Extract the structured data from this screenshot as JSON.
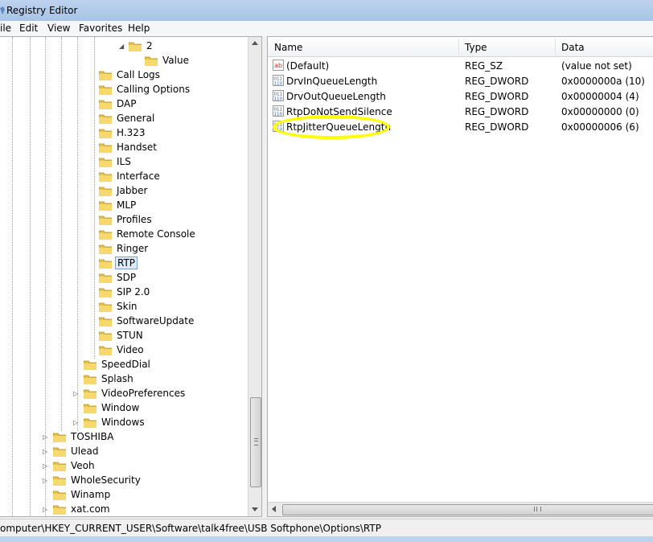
{
  "window": {
    "title": "Registry Editor"
  },
  "menu": [
    "ile",
    "Edit",
    "View",
    "Favorites",
    "Help"
  ],
  "tree": {
    "top": [
      {
        "label": "2",
        "expanded": true
      },
      {
        "label": "Value"
      }
    ],
    "options_children": [
      "Call Logs",
      "Calling Options",
      "DAP",
      "General",
      "H.323",
      "Handset",
      "ILS",
      "Interface",
      "Jabber",
      "MLP",
      "Profiles",
      "Remote Console",
      "Ringer",
      "RTP",
      "SDP",
      "SIP 2.0",
      "Skin",
      "SoftwareUpdate",
      "STUN",
      "Video"
    ],
    "selected": "RTP",
    "softphone_children": [
      {
        "label": "SpeedDial"
      },
      {
        "label": "Splash"
      },
      {
        "label": "VideoPreferences",
        "expandable": true
      },
      {
        "label": "Window"
      },
      {
        "label": "Windows",
        "expandable": true
      }
    ],
    "software_children": [
      {
        "label": "TOSHIBA",
        "expandable": true
      },
      {
        "label": "Ulead",
        "expandable": true
      },
      {
        "label": "Veoh",
        "expandable": true
      },
      {
        "label": "WholeSecurity",
        "expandable": true
      },
      {
        "label": "Winamp"
      },
      {
        "label": "xat.com",
        "expandable": true
      }
    ]
  },
  "list": {
    "columns": {
      "name": "Name",
      "type": "Type",
      "data": "Data"
    },
    "rows": [
      {
        "name": "(Default)",
        "type": "REG_SZ",
        "data": "(value not set)",
        "icon": "string-value-icon"
      },
      {
        "name": "DrvInQueueLength",
        "type": "REG_DWORD",
        "data": "0x0000000a (10)",
        "icon": "binary-value-icon"
      },
      {
        "name": "DrvOutQueueLength",
        "type": "REG_DWORD",
        "data": "0x00000004 (4)",
        "icon": "binary-value-icon"
      },
      {
        "name": "RtpDoNotSendSilence",
        "type": "REG_DWORD",
        "data": "0x00000000 (0)",
        "icon": "binary-value-icon"
      },
      {
        "name": "RtpJitterQueueLength",
        "type": "REG_DWORD",
        "data": "0x00000006 (6)",
        "icon": "binary-value-icon"
      }
    ],
    "highlighted": "RtpJitterQueueLength"
  },
  "status": {
    "path": "omputer\\HKEY_CURRENT_USER\\Software\\talk4free\\USB Softphone\\Options\\RTP"
  },
  "colors": {
    "highlight": "#ffff00",
    "selection": "#dcecfc",
    "folder": "#e8c34a"
  }
}
